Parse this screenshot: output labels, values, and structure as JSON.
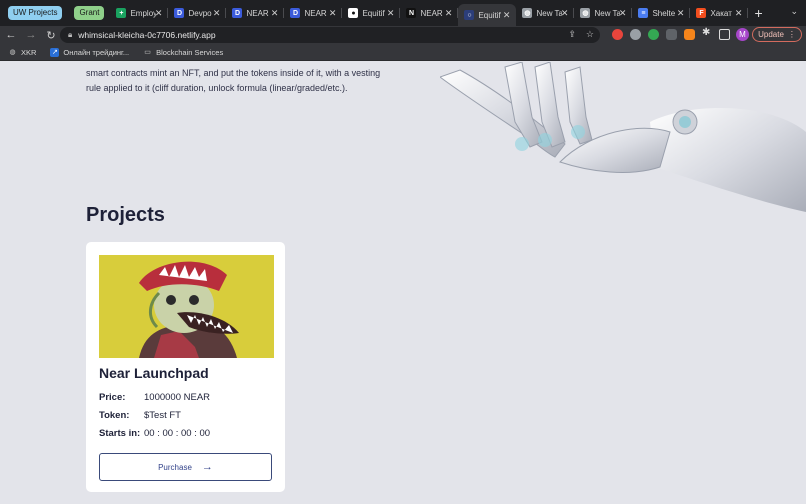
{
  "browser": {
    "tab_groups": [
      {
        "label": "UW Projects",
        "color": "#8fcff0"
      },
      {
        "label": "Grant",
        "color": "#8fd08a"
      }
    ],
    "tabs": [
      {
        "label": "Employ",
        "icon": "green-plus-icon",
        "color": "#1aa260",
        "glyph": "+"
      },
      {
        "label": "Devpo",
        "icon": "dev-d-icon",
        "color": "#3b5bdb",
        "glyph": "D"
      },
      {
        "label": "NEAR",
        "icon": "dev-d-icon",
        "color": "#3b5bdb",
        "glyph": "D"
      },
      {
        "label": "NEAR",
        "icon": "dev-d-icon",
        "color": "#3b5bdb",
        "glyph": "D"
      },
      {
        "label": "Equitif",
        "icon": "github-icon",
        "color": "#ffffff",
        "glyph": "●"
      },
      {
        "label": "NEAR",
        "icon": "near-n-icon",
        "color": "#111111",
        "glyph": "N"
      },
      {
        "label": "Equitif",
        "icon": "circle-icon",
        "color": "#2c3e7a",
        "glyph": "○"
      },
      {
        "label": "New Ta",
        "icon": "globe-icon",
        "color": "#9aa0a6",
        "glyph": "◍"
      },
      {
        "label": "New Ta",
        "icon": "globe-icon",
        "color": "#9aa0a6",
        "glyph": "◍"
      },
      {
        "label": "Shelte",
        "icon": "doc-icon",
        "color": "#4a7cf0",
        "glyph": "≡"
      },
      {
        "label": "Хакат",
        "icon": "figma-icon",
        "color": "#f24e1e",
        "glyph": "F"
      }
    ],
    "active_tab_index": 6,
    "url": "whimsical-kleicha-0c7706.netlify.app",
    "update_label": "Update",
    "avatar_letter": "M",
    "bookmarks": [
      {
        "label": "XKR",
        "icon": "globe-icon"
      },
      {
        "label": "Онлайн трейдинг...",
        "icon": "chart-icon"
      },
      {
        "label": "Blockchain Services",
        "icon": "folder-icon"
      }
    ]
  },
  "page": {
    "intro_text": "smart contracts mint an NFT, and put the tokens inside of it, with a vesting rule applied to it (cliff duration, unlock formula (linear/graded/etc.).",
    "section_title": "Projects",
    "project": {
      "title": "Near Launchpad",
      "price_label": "Price:",
      "price_value": "1000000 NEAR",
      "token_label": "Token:",
      "token_value": "$Test FT",
      "starts_label": "Starts in:",
      "starts_value": "00 : 00 : 00 : 00",
      "purchase_label": "Purchase"
    }
  }
}
